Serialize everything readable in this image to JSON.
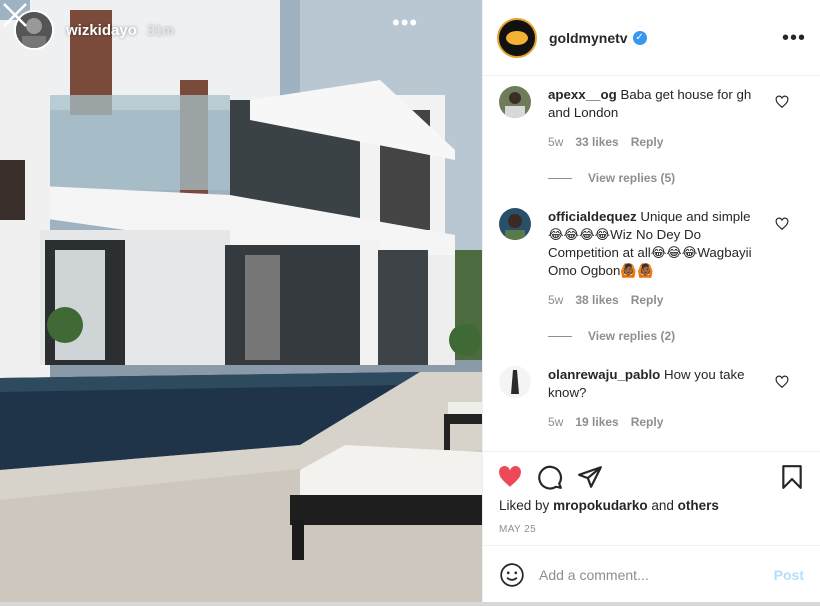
{
  "story": {
    "username": "wizkidayo",
    "time": "31m",
    "more_label": "•••"
  },
  "post": {
    "username": "goldmynetv",
    "verified": true,
    "more_label": "•••"
  },
  "comments": [
    {
      "user": "apexx__og",
      "text": "Baba get house for gh and London",
      "age": "5w",
      "likes": "33 likes",
      "reply": "Reply",
      "view_replies": "View replies (5)"
    },
    {
      "user": "officialdequez",
      "text": "Unique and simple 😂😂😂😂Wiz No Dey Do Competition at all😂😂😂Wagbayii Omo Ogbon🙆🏾🙆🏾",
      "age": "5w",
      "likes": "38 likes",
      "reply": "Reply",
      "view_replies": "View replies (2)"
    },
    {
      "user": "olanrewaju_pablo",
      "text": "How you take know?",
      "age": "5w",
      "likes": "19 likes",
      "reply": "Reply"
    }
  ],
  "likes_line": {
    "prefix": "Liked by",
    "user": "mropokudarko",
    "and": "and",
    "others": "others"
  },
  "date": "MAY 25",
  "add_comment": {
    "placeholder": "Add a comment...",
    "post_label": "Post"
  },
  "colors": {
    "like_red": "#ed4956",
    "verified_blue": "#3897f0",
    "post_disabled": "#b2dffc"
  }
}
